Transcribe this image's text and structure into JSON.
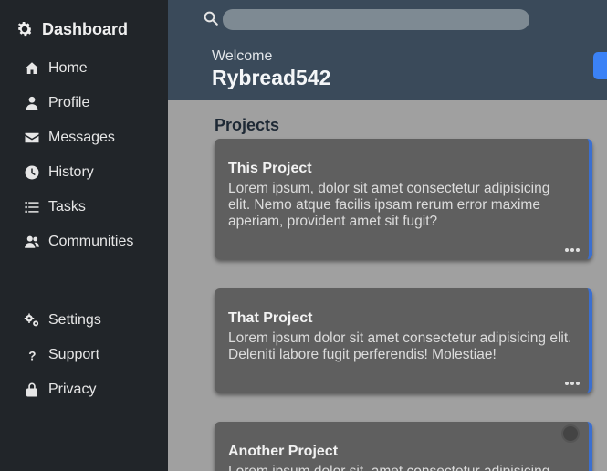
{
  "sidebar": {
    "brand": {
      "label": "Dashboard",
      "icon": "gear-icon"
    },
    "items": [
      {
        "label": "Home",
        "icon": "home-icon"
      },
      {
        "label": "Profile",
        "icon": "user-icon"
      },
      {
        "label": "Messages",
        "icon": "envelope-icon"
      },
      {
        "label": "History",
        "icon": "clock-icon"
      },
      {
        "label": "Tasks",
        "icon": "list-icon"
      },
      {
        "label": "Communities",
        "icon": "users-icon"
      }
    ],
    "bottom_items": [
      {
        "label": "Settings",
        "icon": "gears-icon"
      },
      {
        "label": "Support",
        "icon": "question-icon"
      },
      {
        "label": "Privacy",
        "icon": "lock-icon"
      }
    ]
  },
  "header": {
    "search": {
      "placeholder": "",
      "value": ""
    },
    "welcome": "Welcome",
    "username": "Rybread542"
  },
  "main": {
    "section_title": "Projects",
    "projects": [
      {
        "title": "This Project",
        "body": "Lorem ipsum, dolor sit amet consectetur adipisicing elit. Nemo atque facilis ipsam rerum error maxime aperiam, provident amet sit fugit?"
      },
      {
        "title": "That Project",
        "body": "Lorem ipsum dolor sit amet consectetur adipisicing elit. Deleniti labore fugit perferendis! Molestiae!"
      },
      {
        "title": "Another Project",
        "body": "Lorem ipsum dolor sit, amet consectetur adipisicing"
      }
    ]
  },
  "colors": {
    "sidebar_bg": "#212529",
    "header_bg": "#3a4a5a",
    "main_bg": "#a0a0a0",
    "card_bg": "#5f5f5f",
    "accent": "#3b82f6"
  }
}
